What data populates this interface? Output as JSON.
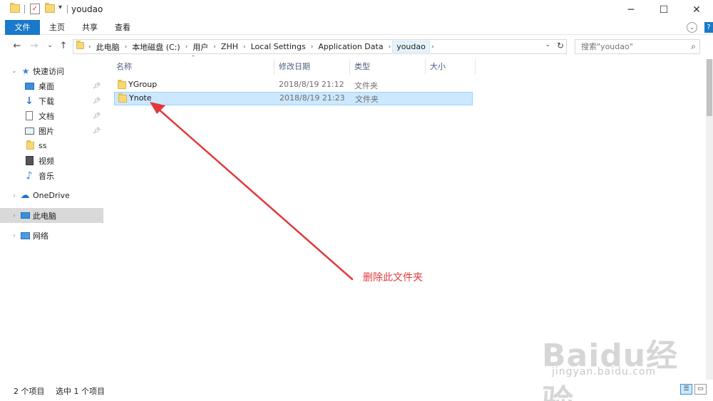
{
  "window": {
    "title": "youdao",
    "controls": {
      "minimize": "─",
      "maximize": "☐",
      "close": "✕"
    }
  },
  "ribbon": {
    "tabs": [
      "文件",
      "主页",
      "共享",
      "查看"
    ],
    "expand": "⌄",
    "help": "?"
  },
  "address": {
    "crumbs": [
      "此电脑",
      "本地磁盘 (C:)",
      "用户",
      "ZHH",
      "Local Settings",
      "Application Data",
      "youdao"
    ],
    "search_placeholder": "搜索\"youdao\""
  },
  "nav": {
    "items": [
      {
        "label": "快速访问",
        "icon": "star-icon"
      },
      {
        "label": "桌面",
        "icon": "desktop-icon",
        "pinned": true
      },
      {
        "label": "下载",
        "icon": "download-icon",
        "pinned": true
      },
      {
        "label": "文档",
        "icon": "document-icon",
        "pinned": true
      },
      {
        "label": "图片",
        "icon": "pictures-icon",
        "pinned": true
      },
      {
        "label": "ss",
        "icon": "folder-icon"
      },
      {
        "label": "视频",
        "icon": "video-icon"
      },
      {
        "label": "音乐",
        "icon": "music-icon"
      },
      {
        "label": "OneDrive",
        "icon": "cloud-icon"
      },
      {
        "label": "此电脑",
        "icon": "computer-icon",
        "selected": true
      },
      {
        "label": "网络",
        "icon": "network-icon"
      }
    ]
  },
  "filelist": {
    "columns": [
      "名称",
      "修改日期",
      "类型",
      "大小"
    ],
    "rows": [
      {
        "name": "YGroup",
        "date": "2018/8/19 21:12",
        "type": "文件夹",
        "size": ""
      },
      {
        "name": "Ynote",
        "date": "2018/8/19 21:23",
        "type": "文件夹",
        "size": "",
        "selected": true
      }
    ]
  },
  "status": {
    "count": "2 个项目",
    "selection": "选中 1 个项目"
  },
  "annotation": {
    "text": "删除此文件夹",
    "color": "#e0393b"
  },
  "watermark": {
    "brand": "Baidu经验",
    "url": "jingyan.baidu.com"
  },
  "colors": {
    "accent": "#1979ca",
    "selection": "#cce8ff",
    "header_text": "#4d6082"
  }
}
